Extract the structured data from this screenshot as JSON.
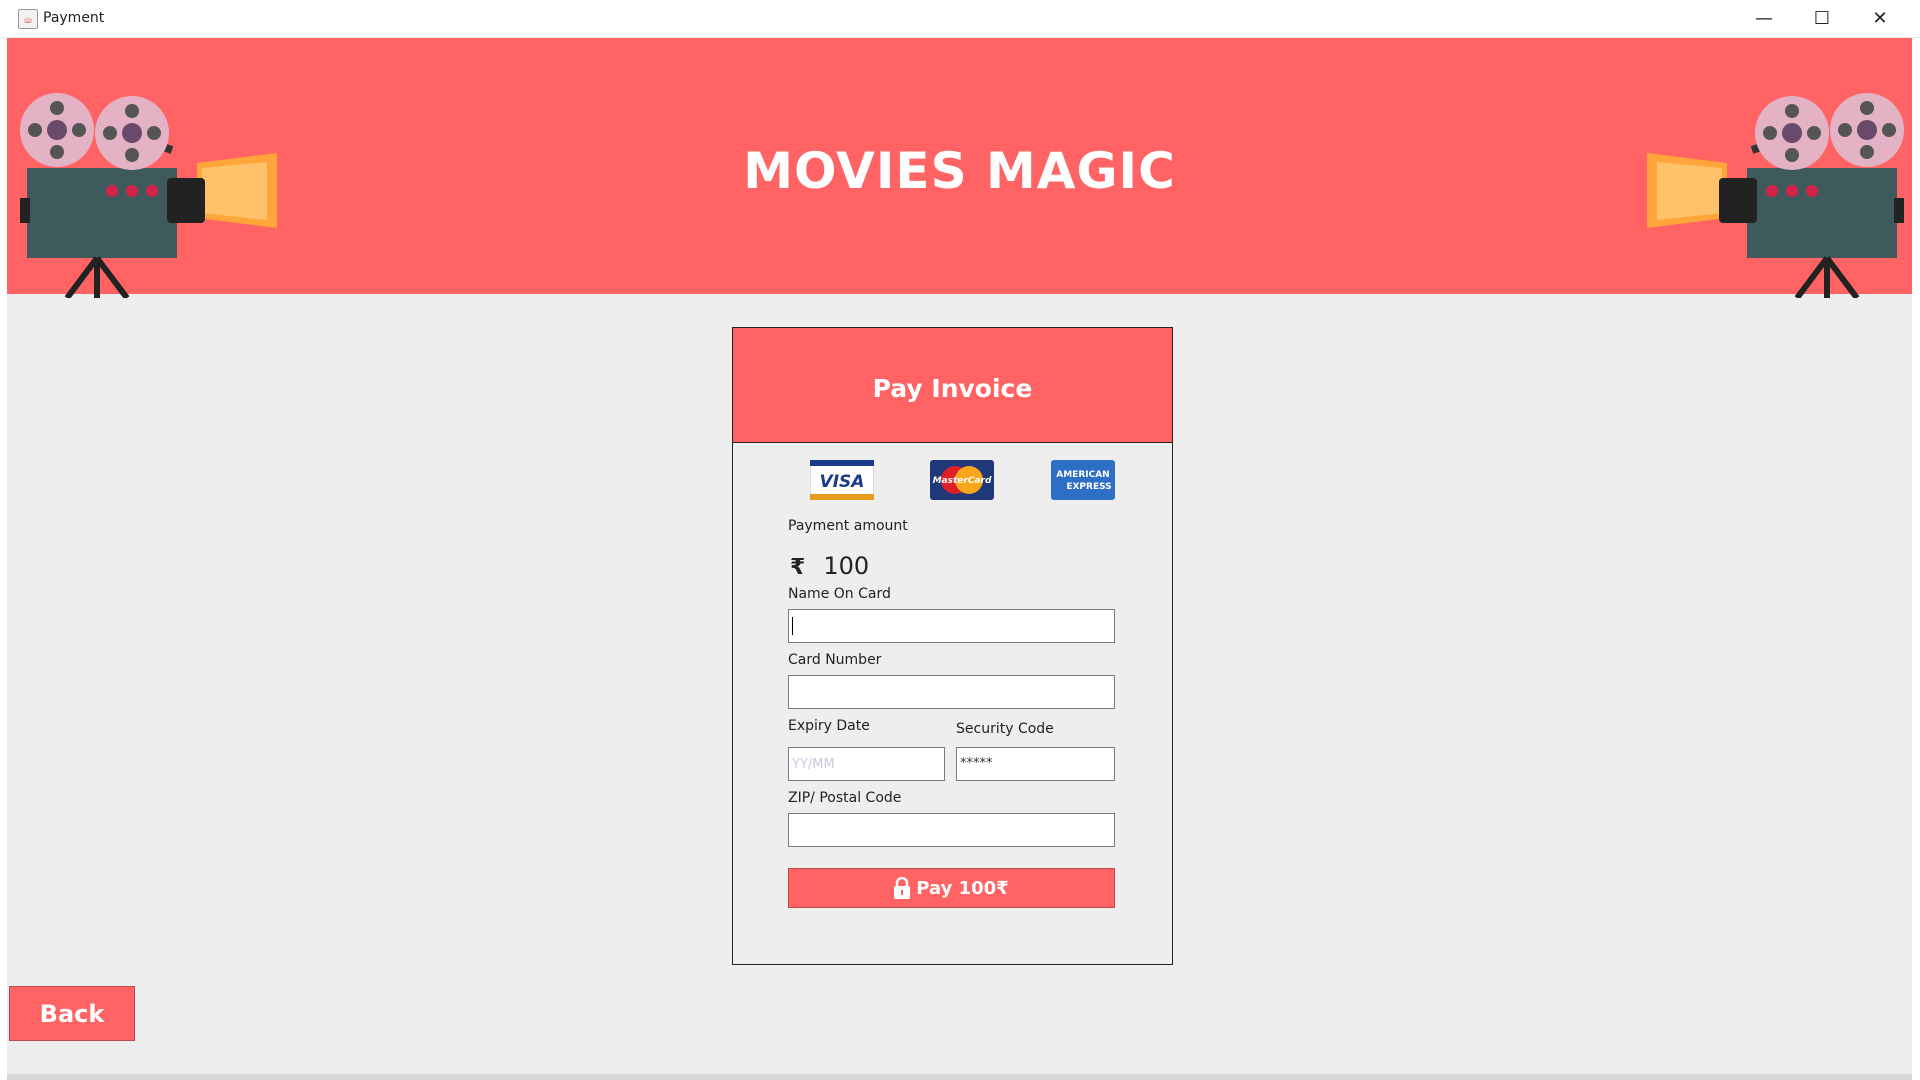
{
  "window": {
    "title": "Payment",
    "minimize": "—",
    "maximize": "☐",
    "close": "✕"
  },
  "header": {
    "title": "MOVIES MAGIC"
  },
  "invoice": {
    "title": "Pay Invoice",
    "payment_amount_label": "Payment amount",
    "currency_symbol": "₹",
    "amount": "100",
    "name_label": "Name On Card",
    "name_value": "",
    "card_number_label": "Card Number",
    "card_number_value": "",
    "expiry_label": "Expiry Date",
    "expiry_placeholder": "YY/MM",
    "security_label": "Security Code",
    "security_value": "*****",
    "zip_label": "ZIP/ Postal Code",
    "zip_value": "",
    "pay_button": "Pay 100₹",
    "card_logos": {
      "visa": "VISA",
      "mastercard": "MasterCard",
      "amex_line1": "AMERICAN",
      "amex_line2": "EXPRESS"
    }
  },
  "back_button": "Back",
  "colors": {
    "accent": "#ff6363",
    "background": "#eeeeee"
  },
  "icons": [
    "java-app-icon",
    "film-projector-icon",
    "visa-logo",
    "mastercard-logo",
    "amex-logo",
    "lock-icon"
  ]
}
